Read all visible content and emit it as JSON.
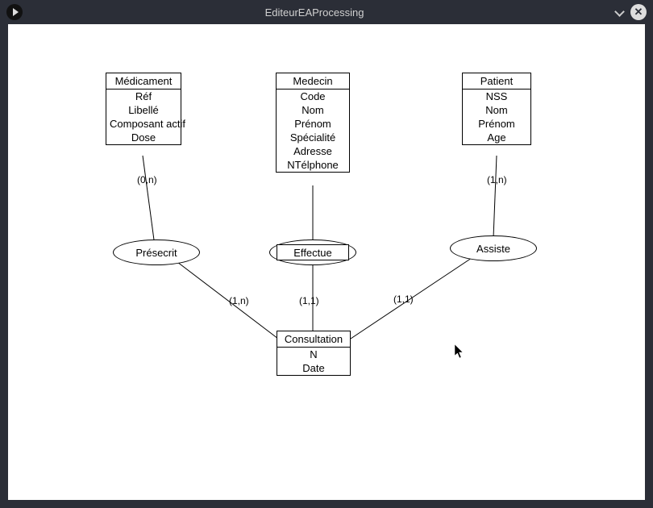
{
  "window": {
    "title": "EditeurEAProcessing"
  },
  "entities": {
    "medicament": {
      "title": "Médicament",
      "attrs": [
        "Réf",
        "Libellé",
        "Composant actif",
        "Dose"
      ]
    },
    "medecin": {
      "title": "Medecin",
      "attrs": [
        "Code",
        "Nom",
        "Prénom",
        "Spécialité",
        "Adresse",
        "NTélphone"
      ]
    },
    "patient": {
      "title": "Patient",
      "attrs": [
        "NSS",
        "Nom",
        "Prénom",
        "Age"
      ]
    },
    "consultation": {
      "title": "Consultation",
      "attrs": [
        "N",
        "Date"
      ]
    }
  },
  "relationships": {
    "presecrit": {
      "label": "Présecrit"
    },
    "effectue": {
      "label": "Effectue"
    },
    "assiste": {
      "label": "Assiste"
    }
  },
  "cardinalities": {
    "med_presecrit": "(0,n)",
    "cons_presecrit": "(1,n)",
    "medc_effectue": "(1,1)",
    "cons_assiste": "(1,1)",
    "pat_assiste": "(1,n)"
  }
}
